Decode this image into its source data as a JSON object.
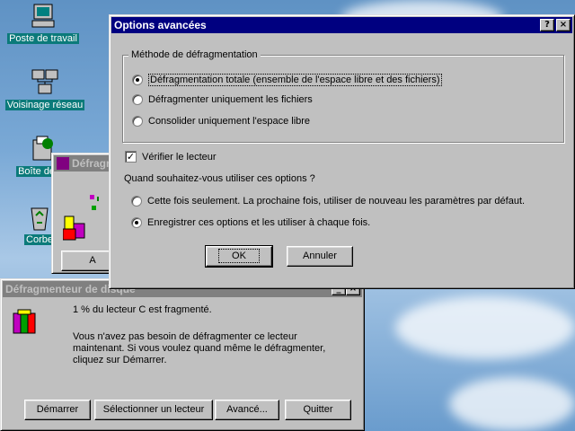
{
  "desktop": {
    "icons": [
      {
        "label": "Poste de travail",
        "icon": "computer-icon"
      },
      {
        "label": "Voisinage réseau",
        "icon": "network-icon"
      },
      {
        "label": "Boîte de ré",
        "icon": "inbox-icon"
      },
      {
        "label": "Corbe",
        "icon": "recycle-bin-icon"
      }
    ]
  },
  "defrag_bg_window": {
    "title": "Défragm",
    "button_label": "A"
  },
  "defrag_window": {
    "title": "Défragmenteur de disque",
    "status": "1 % du lecteur C est fragmenté.",
    "message_line1": "Vous n'avez pas besoin de défragmenter ce lecteur",
    "message_line2": "maintenant. Si vous voulez quand même le défragmenter,",
    "message_line3": "cliquez sur Démarrer.",
    "buttons": {
      "start": "Démarrer",
      "select_drive": "Sélectionner un lecteur",
      "advanced": "Avancé...",
      "quit": "Quitter"
    }
  },
  "options_dialog": {
    "title": "Options avancées",
    "help_button": "?",
    "close_button": "×",
    "method_group": {
      "legend": "Méthode de défragmentation",
      "options": [
        {
          "label": "Défragmentation totale (ensemble de l'espace libre et des fichiers)",
          "selected": true
        },
        {
          "label": "Défragmenter uniquement les fichiers",
          "selected": false
        },
        {
          "label": "Consolider uniquement l'espace libre",
          "selected": false
        }
      ]
    },
    "check_drive": {
      "label": "Vérifier le lecteur",
      "checked": true,
      "mark": "✓"
    },
    "question": "Quand souhaitez-vous utiliser ces options ?",
    "usage_options": [
      {
        "label": "Cette fois seulement. La prochaine fois, utiliser de nouveau les paramètres par défaut.",
        "selected": false
      },
      {
        "label": "Enregistrer ces options et les utiliser à chaque fois.",
        "selected": true
      }
    ],
    "ok_button": "OK",
    "cancel_button": "Annuler"
  },
  "colors": {
    "title_active": "#000080",
    "title_inactive": "#808080",
    "window_face": "#c0c0c0",
    "desktop_label_bg": "#0b7a7a"
  }
}
